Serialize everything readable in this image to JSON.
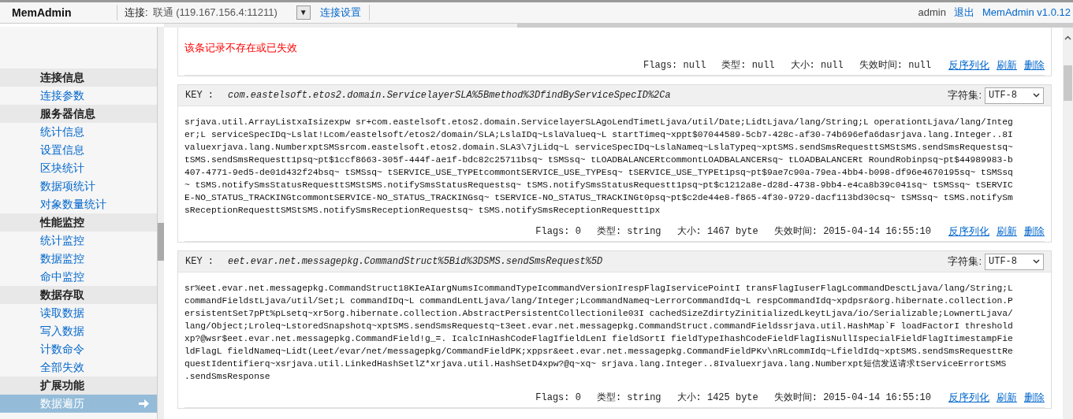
{
  "header": {
    "brand": "MemAdmin",
    "connection_label": "连接:",
    "connection_value": "联通 (119.167.156.4:11211)",
    "dropdown_glyph": "▼",
    "settings_link": "连接设置",
    "user": "admin",
    "logout": "退出",
    "version": "MemAdmin v1.0.12"
  },
  "sidebar": [
    {
      "title": "连接信息",
      "items": [
        {
          "label": "连接参数",
          "selected": false
        }
      ]
    },
    {
      "title": "服务器信息",
      "items": [
        {
          "label": "统计信息",
          "selected": false
        },
        {
          "label": "设置信息",
          "selected": false
        },
        {
          "label": "区块统计",
          "selected": false
        },
        {
          "label": "数据项统计",
          "selected": false
        },
        {
          "label": "对象数量统计",
          "selected": false
        }
      ]
    },
    {
      "title": "性能监控",
      "items": [
        {
          "label": "统计监控",
          "selected": false
        },
        {
          "label": "数据监控",
          "selected": false
        },
        {
          "label": "命中监控",
          "selected": false
        }
      ]
    },
    {
      "title": "数据存取",
      "items": [
        {
          "label": "读取数据",
          "selected": false
        },
        {
          "label": "写入数据",
          "selected": false
        },
        {
          "label": "计数命令",
          "selected": false
        },
        {
          "label": "全部失效",
          "selected": false
        }
      ]
    },
    {
      "title": "扩展功能",
      "items": [
        {
          "label": "数据遍历",
          "selected": true
        }
      ]
    }
  ],
  "records": [
    {
      "kind": "missing",
      "message": "该条记录不存在或已失效",
      "meta": [
        {
          "label": "Flags:",
          "value": "null"
        },
        {
          "label": "类型:",
          "value": "null"
        },
        {
          "label": "大小:",
          "value": "null"
        },
        {
          "label": "失效时间:",
          "value": "null"
        }
      ],
      "actions": [
        "反序列化",
        "刷新",
        "删除"
      ]
    },
    {
      "kind": "entry",
      "key_label": "KEY :",
      "key": "com.eastelsoft.etos2.domain.ServicelayerSLA%5Bmethod%3DfindByServiceSpecID%2Ca",
      "charset_label": "字符集:",
      "charset": "UTF-8",
      "value_lines": [
        "srjava.util.ArrayListxaIsizexpw sr+com.eastelsoft.etos2.domain.ServicelayerSLAgoLendTimetLjava/util/Date;LidtLjava/lang/String;L operationtLjava/lang/Integ",
        "er;L serviceSpecIDq~Lslat!Lcom/eastelsoft/etos2/domain/SLA;LslaIDq~LslaValueq~L startTimeq~xppt$07044589-5cb7-428c-af30-74b696efa6dasrjava.lang.Integer..8I",
        "valuexrjava.lang.NumberxptSMSsrcom.eastelsoft.etos2.domain.SLA3\\7jLidq~L serviceSpecIDq~LslaNameq~LslaTypeq~xptSMS.sendSmsRequesttSMStSMS.sendSmsRequestsq~",
        "tSMS.sendSmsRequestt1psq~pt$1ccf8663-305f-444f-ae1f-bdc82c25711bsq~ tSMSsq~ tLOADBALANCERtcommontLOADBALANCERsq~ tLOADBALANCERt RoundRobinpsq~pt$44989983-b",
        "407-4771-9ed5-de01d432f24bsq~ tSMSsq~ tSERVICE_USE_TYPEtcommontSERVICE_USE_TYPEsq~ tSERVICE_USE_TYPEt1psq~pt$9ae7c90a-79ea-4bb4-b098-df96e4670195sq~ tSMSsq",
        "~ tSMS.notifySmsStatusRequesttSMStSMS.notifySmsStatusRequestsq~ tSMS.notifySmsStatusRequestt1psq~pt$c1212a8e-d28d-4738-9bb4-e4ca8b39c041sq~ tSMSsq~ tSERVIC",
        "E-NO_STATUS_TRACKINGtcommontSERVICE-NO_STATUS_TRACKINGsq~ tSERVICE-NO_STATUS_TRACKINGt0psq~pt$c2de44e8-f865-4f30-9729-dacf113bd30csq~ tSMSsq~ tSMS.notifySm",
        "sReceptionRequesttSMStSMS.notifySmsReceptionRequestsq~ tSMS.notifySmsReceptionRequestt1px"
      ],
      "meta": [
        {
          "label": "Flags:",
          "value": "0"
        },
        {
          "label": "类型:",
          "value": "string"
        },
        {
          "label": "大小:",
          "value": "1467 byte"
        },
        {
          "label": "失效时间:",
          "value": "2015-04-14 16:55:10"
        }
      ],
      "actions": [
        "反序列化",
        "刷新",
        "删除"
      ]
    },
    {
      "kind": "entry",
      "key_label": "KEY :",
      "key": "eet.evar.net.messagepkg.CommandStruct%5Bid%3DSMS.sendSmsRequest%5D",
      "charset_label": "字符集:",
      "charset": "UTF-8",
      "value_lines": [
        "sr%eet.evar.net.messagepkg.CommandStruct18KIeAIargNumsIcommandTypeIcommandVersionIrespFlagIservicePointI transFlagIuserFlagLcommandDesctLjava/lang/String;L",
        "commandFieldstLjava/util/Set;L commandIDq~L commandLentLjava/lang/Integer;LcommandNameq~LerrorCommandIdq~L respCommandIdq~xpdpsr&org.hibernate.collection.P",
        "ersistentSet7pPt%pLsetq~xr5org.hibernate.collection.AbstractPersistentCollectionile03I cachedSizeZdirtyZinitializedLkeytLjava/io/Serializable;LownertLjava/",
        "lang/Object;Lroleq~LstoredSnapshotq~xptSMS.sendSmsRequestq~t3eet.evar.net.messagepkg.CommandStruct.commandFieldssrjava.util.HashMap`F loadFactorI threshold",
        "xp?@wsr$eet.evar.net.messagepkg.CommandField!g_=. IcalcInHashCodeFlagIfieldLenI fieldSortI fieldTypeIhashCodeFieldFlagIisNullIspecialFieldFlagItimestampFie",
        "ldFlagL fieldNameq~Lidt(Leet/evar/net/messagepkg/CommandFieldPK;xppsr&eet.evar.net.messagepkg.CommandFieldPKv\\nRLcommIdq~LfieldIdq~xptSMS.sendSmsRequesttRe",
        "questIdentifierq~xsrjava.util.LinkedHashSetlZ*xrjava.util.HashSetD4xpw?@q~xq~ srjava.lang.Integer..8Ivaluexrjava.lang.Numberxpt短信发送请求tServiceErrortSMS",
        ".sendSmsResponse"
      ],
      "meta": [
        {
          "label": "Flags:",
          "value": "0"
        },
        {
          "label": "类型:",
          "value": "string"
        },
        {
          "label": "大小:",
          "value": "1425 byte"
        },
        {
          "label": "失效时间:",
          "value": "2015-04-14 16:55:10"
        }
      ],
      "actions": [
        "反序列化",
        "刷新",
        "删除"
      ]
    }
  ]
}
